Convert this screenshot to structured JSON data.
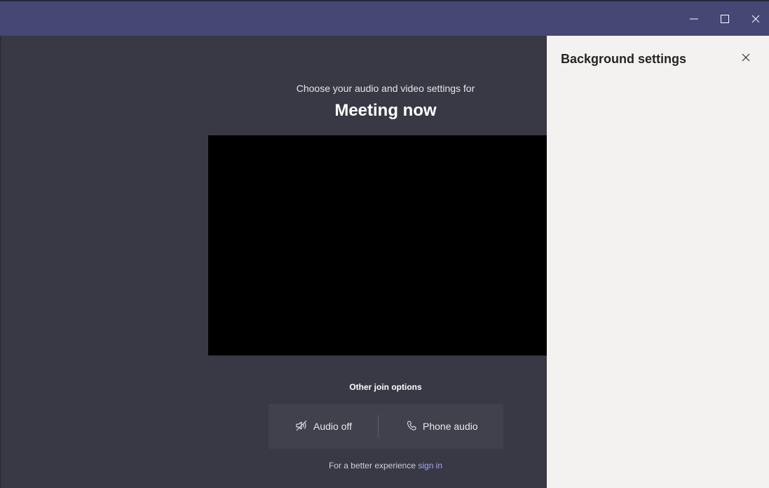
{
  "window": {
    "titlebar_color": "#464775",
    "controls": {
      "minimize_icon": "minimize-icon",
      "maximize_icon": "maximize-icon",
      "close_icon": "close-icon"
    }
  },
  "prejoin": {
    "subtitle": "Choose your audio and video settings for",
    "meeting_title": "Meeting now",
    "other_join_label": "Other join options",
    "options": [
      {
        "label": "Audio off",
        "icon": "speaker-off-icon"
      },
      {
        "label": "Phone audio",
        "icon": "phone-icon"
      }
    ],
    "footer_text": "For a better experience ",
    "footer_link": "sign in"
  },
  "background_panel": {
    "title": "Background settings",
    "close_icon": "close-icon"
  },
  "colors": {
    "accent": "#464775",
    "main_bg": "#393945",
    "panel_bg": "#f3f2f1",
    "link": "#a3a6ee"
  }
}
